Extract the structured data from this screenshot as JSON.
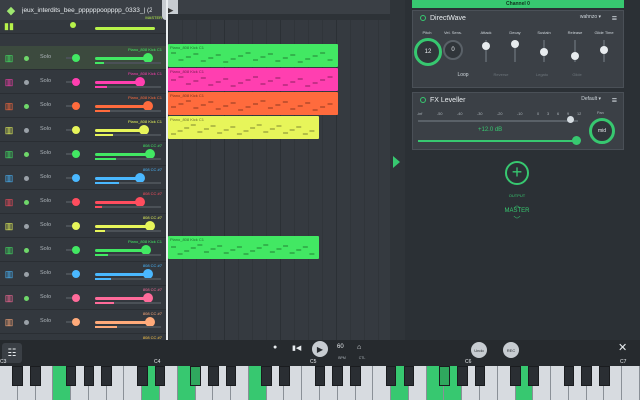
{
  "app": {
    "title": "jeux_interdits_bee_ppppppoopppp_0333_| (2",
    "channel_label": "Channel 0"
  },
  "colors": {
    "accent": "#37c870",
    "lime": "#b7f24a",
    "pink": "#ff3fb0",
    "orange": "#ff6b3d",
    "yellow": "#e7f55a",
    "green": "#42e863",
    "cyan": "#4ab8ff",
    "red": "#ff4d5e",
    "peach": "#ffaa7a",
    "gold": "#ffc94a"
  },
  "rack": {
    "rows": [
      {
        "name": "MASTER",
        "solo": "",
        "color": "#b7f24a",
        "icon": "meter-icon"
      },
      {
        "name": "Piano_808 Kick C1",
        "solo": "Solo",
        "color": "#42e863",
        "icon": "piano-icon"
      },
      {
        "name": "Piano_808 Kick C1",
        "solo": "Solo",
        "color": "#ff3fb0",
        "icon": "piano-icon"
      },
      {
        "name": "Piano_808 Kick C1",
        "solo": "Solo",
        "color": "#ff6b3d",
        "icon": "piano-icon"
      },
      {
        "name": "Piano_808 Kick C1",
        "solo": "Solo",
        "color": "#e7f55a",
        "icon": "piano-icon"
      },
      {
        "name": "808 CC #7",
        "solo": "Solo",
        "color": "#42e863",
        "icon": "piano-icon"
      },
      {
        "name": "808 CC #7",
        "solo": "Solo",
        "color": "#4ab8ff",
        "icon": "piano-icon"
      },
      {
        "name": "808 CC #7",
        "solo": "Solo",
        "color": "#ff4d5e",
        "icon": "piano-icon"
      },
      {
        "name": "808 CC #7",
        "solo": "Solo",
        "color": "#e7f55a",
        "icon": "piano-icon"
      },
      {
        "name": "Piano_808 Kick C1",
        "solo": "Solo",
        "color": "#42e863",
        "icon": "piano-icon"
      },
      {
        "name": "808 CC #7",
        "solo": "Solo",
        "color": "#4ab8ff",
        "icon": "piano-icon"
      },
      {
        "name": "808 CC #7",
        "solo": "Solo",
        "color": "#ff6b9a",
        "icon": "piano-icon"
      },
      {
        "name": "808 CC #7",
        "solo": "Solo",
        "color": "#ffaa7a",
        "icon": "piano-icon"
      },
      {
        "name": "808 CC #7",
        "solo": "Solo",
        "color": "#ffc94a",
        "icon": "piano-icon"
      }
    ]
  },
  "clips": [
    {
      "label": "Piano_808 Kick C1",
      "color": "#42e863"
    },
    {
      "label": "Piano_808 Kick C1",
      "color": "#ff3fb0"
    },
    {
      "label": "Piano_808 Kick C1",
      "color": "#ff6b3d"
    },
    {
      "label": "Piano_808 Kick C1",
      "color": "#e7f55a"
    },
    {
      "label": "Piano_808 Kick C1",
      "color": "#42e863"
    }
  ],
  "directwave": {
    "name": "DirectWave",
    "preset": "wahnzo",
    "controls": [
      {
        "label": "Pitch",
        "value": "12",
        "dim": false
      },
      {
        "label": "Vel. Sens.",
        "value": "0",
        "dim": false
      },
      {
        "label": "Attack",
        "value": "",
        "dim": false
      },
      {
        "label": "Decay",
        "value": "",
        "dim": false
      },
      {
        "label": "Sustain",
        "value": "",
        "dim": false
      },
      {
        "label": "Release",
        "value": "",
        "dim": false
      },
      {
        "label": "Glide Time",
        "value": "",
        "dim": false
      }
    ],
    "toggles": [
      {
        "label": "Loop",
        "dim": false
      },
      {
        "label": "Reverse",
        "dim": true
      },
      {
        "label": "Legato",
        "dim": true
      },
      {
        "label": "Glide",
        "dim": true
      }
    ]
  },
  "fxleveller": {
    "name": "FX Leveller",
    "preset": "Default",
    "gain": "+12.0 dB",
    "ticks": [
      "-inf",
      "-50",
      "-40",
      "-30",
      "-20",
      "-10",
      "0",
      "3",
      "6",
      "9",
      "12"
    ],
    "pan_label": "Pan",
    "pan_value": "mid"
  },
  "insert": {
    "label": "MASTER",
    "sub": "OUTPUT"
  },
  "transport": {
    "tempo": "60",
    "tempo_sub": "BPM",
    "rec_sub": "REC",
    "ctl_sub": "CTL",
    "btn1": "Undo",
    "btn2": "REC"
  },
  "keyboard": {
    "octaves": [
      "C3",
      "C4",
      "C5",
      "C6",
      "C7"
    ]
  }
}
